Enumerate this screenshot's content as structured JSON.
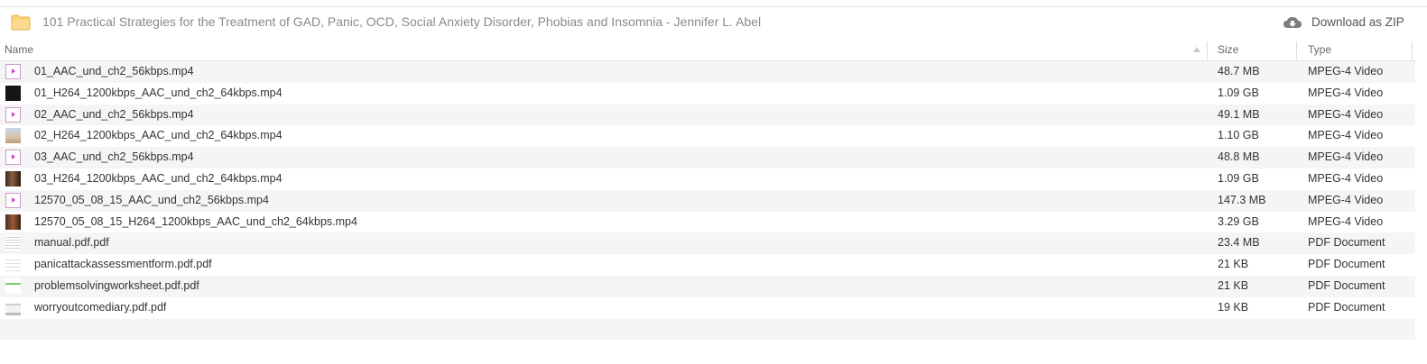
{
  "header": {
    "title": "101 Practical Strategies for the Treatment of GAD, Panic, OCD, Social Anxiety Disorder, Phobias and Insomnia - Jennifer L. Abel",
    "download_label": "Download as ZIP",
    "folder_icon": "folder-icon",
    "download_icon": "download-icon"
  },
  "columns": {
    "name": "Name",
    "size": "Size",
    "type": "Type",
    "sort_icon": "sort-ascending-icon"
  },
  "colors": {
    "accent_folder": "#fbd27b",
    "video_icon": "#c04ec0",
    "row_alt": "#f5f5f5"
  },
  "files": [
    {
      "name": "01_AAC_und_ch2_56kbps.mp4",
      "size": "48.7 MB",
      "type": "MPEG-4 Video",
      "icon": "video-file-icon"
    },
    {
      "name": "01_H264_1200kbps_AAC_und_ch2_64kbps.mp4",
      "size": "1.09 GB",
      "type": "MPEG-4 Video",
      "icon": "video-thumbnail-icon"
    },
    {
      "name": "02_AAC_und_ch2_56kbps.mp4",
      "size": "49.1 MB",
      "type": "MPEG-4 Video",
      "icon": "video-file-icon"
    },
    {
      "name": "02_H264_1200kbps_AAC_und_ch2_64kbps.mp4",
      "size": "1.10 GB",
      "type": "MPEG-4 Video",
      "icon": "video-thumbnail-icon"
    },
    {
      "name": "03_AAC_und_ch2_56kbps.mp4",
      "size": "48.8 MB",
      "type": "MPEG-4 Video",
      "icon": "video-file-icon"
    },
    {
      "name": "03_H264_1200kbps_AAC_und_ch2_64kbps.mp4",
      "size": "1.09 GB",
      "type": "MPEG-4 Video",
      "icon": "video-thumbnail-icon"
    },
    {
      "name": "12570_05_08_15_AAC_und_ch2_56kbps.mp4",
      "size": "147.3 MB",
      "type": "MPEG-4 Video",
      "icon": "video-file-icon"
    },
    {
      "name": "12570_05_08_15_H264_1200kbps_AAC_und_ch2_64kbps.mp4",
      "size": "3.29 GB",
      "type": "MPEG-4 Video",
      "icon": "video-thumbnail-icon"
    },
    {
      "name": "manual.pdf.pdf",
      "size": "23.4 MB",
      "type": "PDF Document",
      "icon": "pdf-thumbnail-icon"
    },
    {
      "name": "panicattackassessmentform.pdf.pdf",
      "size": "21 KB",
      "type": "PDF Document",
      "icon": "pdf-thumbnail-icon"
    },
    {
      "name": "problemsolvingworksheet.pdf.pdf",
      "size": "21 KB",
      "type": "PDF Document",
      "icon": "pdf-thumbnail-icon"
    },
    {
      "name": "worryoutcomediary.pdf.pdf",
      "size": "19 KB",
      "type": "PDF Document",
      "icon": "pdf-thumbnail-icon"
    }
  ]
}
